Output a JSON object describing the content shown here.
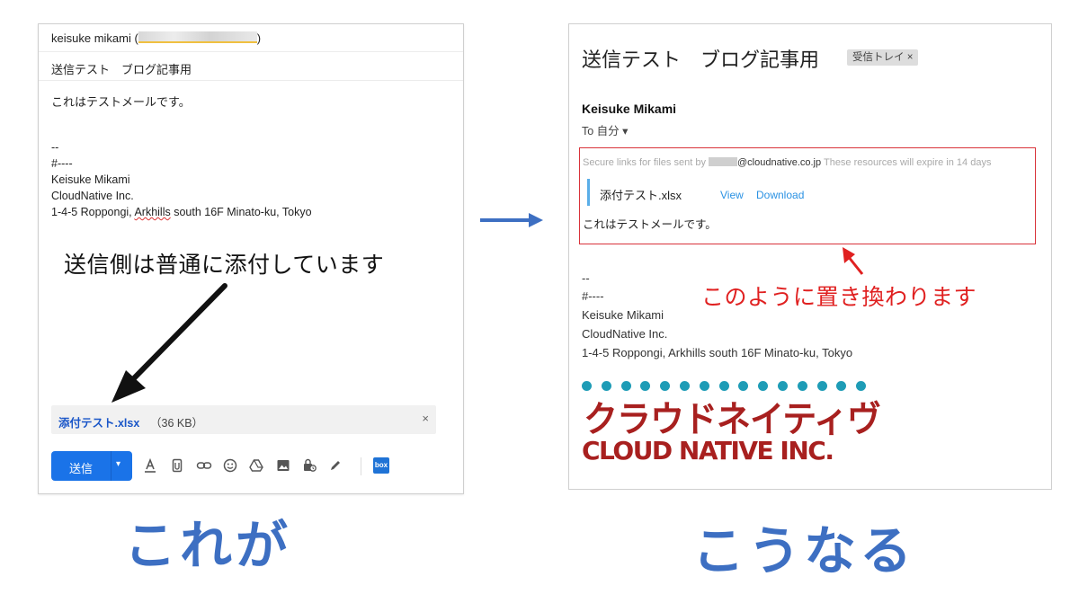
{
  "compose": {
    "to_name": "keisuke mikami (",
    "to_close": ")",
    "subject": "送信テスト　ブログ記事用",
    "body": "これはテストメールです。",
    "signature": [
      "--",
      "#----",
      "Keisuke Mikami",
      "CloudNative Inc.",
      "1-4-5 Roppongi, ",
      "Arkhills",
      " south 16F Minato-ku, Tokyo"
    ],
    "note": "送信側は普通に添付しています",
    "attachment_name": "添付テスト.xlsx",
    "attachment_size": "（36 KB）",
    "attachment_close": "×",
    "send_label": "送信",
    "send_caret": "▾",
    "box_label": "box",
    "toolbar_icons": [
      "format-text-icon",
      "attach-file-icon",
      "insert-link-icon",
      "emoji-icon",
      "google-drive-icon",
      "insert-photo-icon",
      "confidential-mode-icon",
      "signature-pen-icon",
      "box-icon"
    ]
  },
  "received": {
    "subject": "送信テスト　ブログ記事用",
    "chip": "受信トレイ ×",
    "sender": "Keisuke Mikami",
    "to": "To 自分 ▾",
    "secure_prefix": "Secure links for files sent by ",
    "secure_domain": "@cloudnative.co.jp",
    "secure_suffix": "  These resources will expire in 14 days",
    "file_name": "添付テスト.xlsx",
    "view": "View",
    "download": "Download",
    "body": "これはテストメールです。",
    "signature": [
      "--",
      "#----",
      "Keisuke Mikami",
      "CloudNative Inc.",
      "1-4-5 Roppongi, Arkhills south 16F Minato-ku, Tokyo"
    ],
    "note": "このように置き換わります",
    "logo_jp": "クラウドネイティヴ",
    "logo_en": "CLOUD NATIVE INC."
  },
  "captions": {
    "left": "これが",
    "right": "こうなる"
  },
  "colors": {
    "caption": "#3d6fc2",
    "note_red": "#e02020",
    "secure_border": "#d9333a",
    "send_button": "#1a73e8",
    "logo": "#a8201f",
    "logo_dots": "#1e9cb6",
    "arrow_blue": "#3d6fc2"
  }
}
